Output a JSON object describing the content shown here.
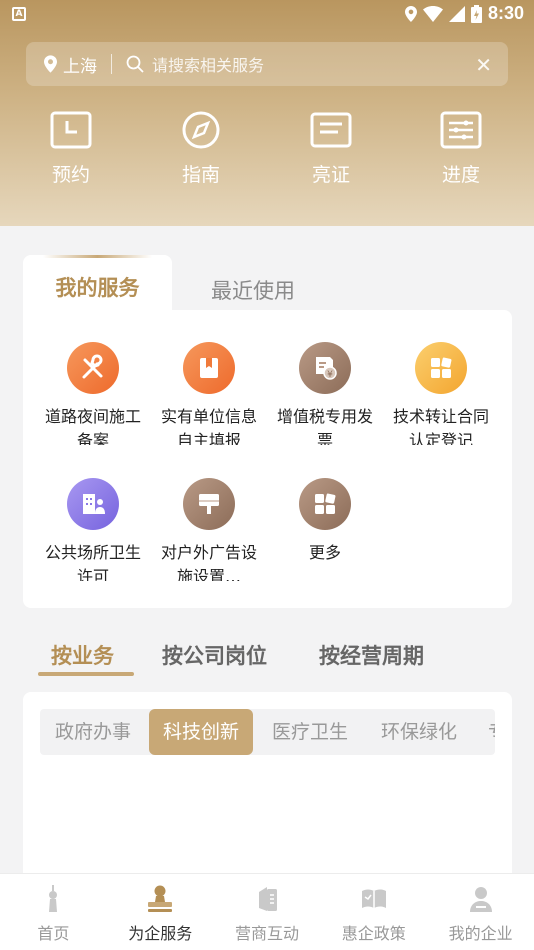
{
  "status_bar": {
    "time": "8:30"
  },
  "search": {
    "city": "上海",
    "placeholder": "请搜索相关服务"
  },
  "quick_actions": [
    {
      "label": "预约",
      "icon": "calendar-clock-icon"
    },
    {
      "label": "指南",
      "icon": "compass-icon"
    },
    {
      "label": "亮证",
      "icon": "certificate-icon"
    },
    {
      "label": "进度",
      "icon": "progress-list-icon"
    }
  ],
  "service_tabs": {
    "active": "我的服务",
    "inactive": "最近使用"
  },
  "services": [
    {
      "label": "道路夜间施工备案",
      "icon": "tools-icon",
      "color": "#f07a3a"
    },
    {
      "label": "实有单位信息自主填报",
      "icon": "book-icon",
      "color": "#f07a3a"
    },
    {
      "label": "增值税专用发票",
      "icon": "invoice-icon",
      "color": "#9b7a66"
    },
    {
      "label": "技术转让合同认定登记",
      "icon": "grid-icon",
      "color": "#f6b540"
    },
    {
      "label": "公共场所卫生许可",
      "icon": "building-person-icon",
      "color": "#8a78e6"
    },
    {
      "label": "对户外广告设施设置…",
      "icon": "billboard-icon",
      "color": "#9b7a66"
    },
    {
      "label": "更多",
      "icon": "more-apps-icon",
      "color": "#9b7a66"
    }
  ],
  "category_tabs": [
    {
      "label": "按业务",
      "active": true
    },
    {
      "label": "按公司岗位",
      "active": false
    },
    {
      "label": "按经营周期",
      "active": false
    }
  ],
  "sub_categories": [
    {
      "label": "政府办事",
      "active": false
    },
    {
      "label": "科技创新",
      "active": true
    },
    {
      "label": "医疗卫生",
      "active": false
    },
    {
      "label": "环保绿化",
      "active": false
    },
    {
      "label": "专",
      "active": false
    }
  ],
  "bottom_nav": [
    {
      "label": "首页",
      "icon": "home-tower-icon",
      "active": false
    },
    {
      "label": "为企服务",
      "icon": "stamp-icon",
      "active": true
    },
    {
      "label": "营商互动",
      "icon": "interaction-icon",
      "active": false
    },
    {
      "label": "惠企政策",
      "icon": "policy-icon",
      "active": false
    },
    {
      "label": "我的企业",
      "icon": "user-enterprise-icon",
      "active": false
    }
  ],
  "colors": {
    "accent": "#c8a876",
    "accent_text": "#b48f55"
  }
}
